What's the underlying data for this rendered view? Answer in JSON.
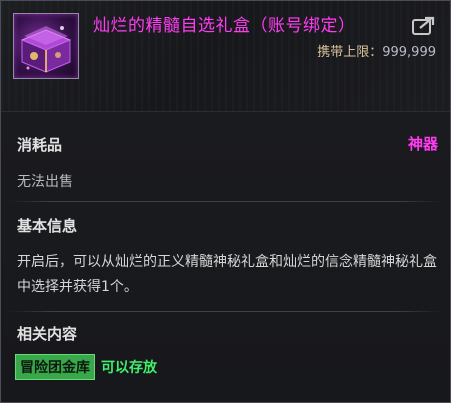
{
  "item": {
    "title": "灿烂的精髓自选礼盒（账号绑定）",
    "icon": "purple-treasure-box-icon",
    "carry_limit_label": "携带上限：",
    "carry_limit_value": "999,999"
  },
  "details": {
    "type": "消耗品",
    "rarity": "神器",
    "sell_status": "无法出售"
  },
  "basic_info": {
    "heading": "基本信息",
    "description": "开启后，可以从灿烂的正义精髓神秘礼盒和灿烂的信念精髓神秘礼盒中选择并获得1个。"
  },
  "related": {
    "heading": "相关内容",
    "storage_badge": "冒险团金库",
    "storage_note": "可以存放"
  },
  "colors": {
    "rarity": "#ff3cf2",
    "storage_badge": "#38a84a",
    "storage_note": "#3ff06a"
  }
}
